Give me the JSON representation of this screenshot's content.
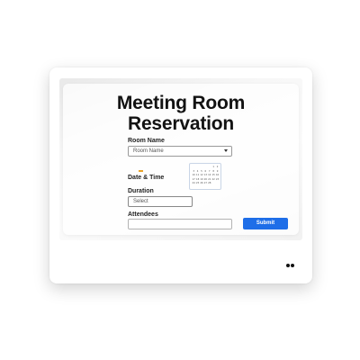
{
  "form": {
    "title_line1": "Meeting Room",
    "title_line2": "Reservation",
    "room_name_label": "Room Name",
    "room_name_placeholder": "Room Name",
    "date_time_label": "Date & Time",
    "duration_label": "Duration",
    "duration_value": "Select",
    "attendees_label": "Attendees",
    "attendees_value": "",
    "submit_label": "Submit"
  },
  "calendar": {
    "days": [
      "",
      "",
      "",
      "",
      "",
      "1",
      "2",
      "3",
      "4",
      "5",
      "6",
      "7",
      "8",
      "9",
      "10",
      "11",
      "12",
      "13",
      "14",
      "15",
      "16",
      "17",
      "18",
      "19",
      "20",
      "21",
      "22",
      "23",
      "24",
      "25",
      "26",
      "27",
      "28",
      "",
      ""
    ]
  },
  "colors": {
    "accent": "#1e6ee8",
    "marker": "#e9a227"
  },
  "icons": {
    "caret": "chevron-down-icon",
    "pager": "pagination-dots-icon"
  }
}
